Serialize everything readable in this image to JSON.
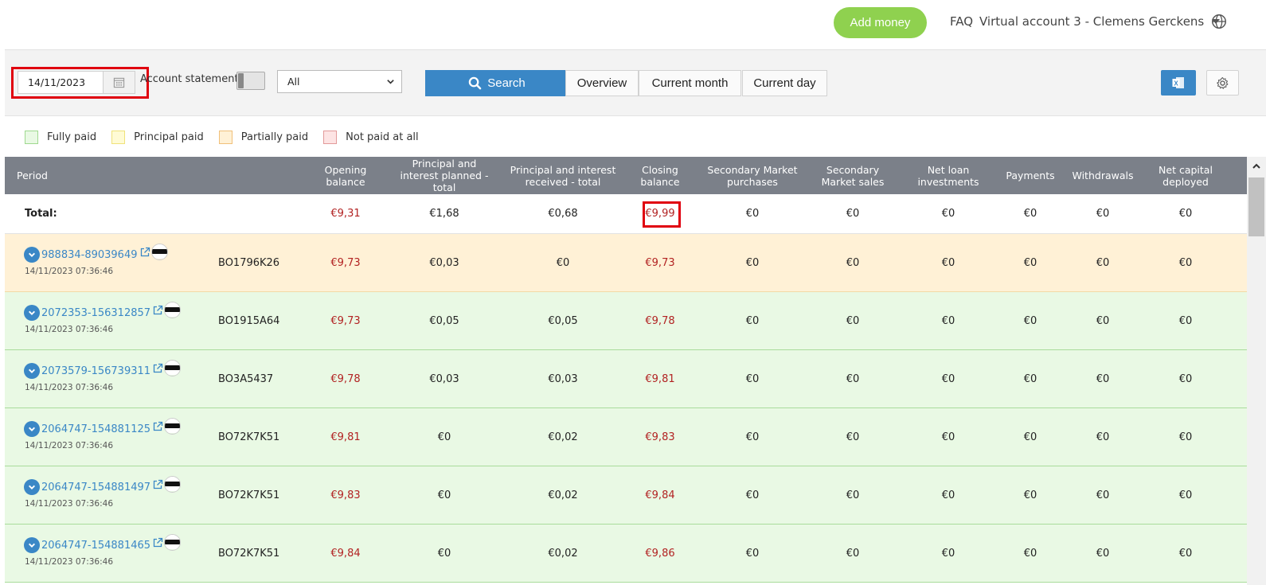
{
  "header": {
    "add_money_label": "Add money",
    "faq_label": "FAQ",
    "account_label": "Virtual account 3 - Clemens Gerckens",
    "icons": [
      "chevron-down-icon",
      "globe-icon"
    ]
  },
  "filters": {
    "date_value": "14/11/2023",
    "account_statement_label": "Account statement",
    "select_value": "All",
    "search_label": "Search",
    "overview_label": "Overview",
    "current_month_label": "Current month",
    "current_day_label": "Current day",
    "icons": [
      "calendar-icon",
      "search-icon",
      "excel-icon",
      "gear-icon"
    ]
  },
  "legend": [
    {
      "label": "Fully paid",
      "fill": "#e9f9e4",
      "border": "#9fd98f"
    },
    {
      "label": "Principal paid",
      "fill": "#fffbd5",
      "border": "#f0e27a"
    },
    {
      "label": "Partially paid",
      "fill": "#fff1d6",
      "border": "#f0c07a"
    },
    {
      "label": "Not paid at all",
      "fill": "#fde4e4",
      "border": "#e29a9a"
    }
  ],
  "table": {
    "columns": [
      "Period",
      "Opening balance",
      "Principal and interest planned - total",
      "Principal and interest received - total",
      "Closing balance",
      "Secondary Market purchases",
      "Secondary Market sales",
      "Net loan investments",
      "Payments",
      "Withdrawals",
      "Net capital deployed"
    ],
    "total": {
      "label": "Total:",
      "opening": "€9,31",
      "planned": "€1,68",
      "received": "€0,68",
      "closing": "€9,99",
      "sm_purchases": "€0",
      "sm_sales": "€0",
      "net_loan": "€0",
      "payments": "€0",
      "withdrawals": "€0",
      "net_capital": "€0"
    },
    "rows": [
      {
        "status": "partial",
        "loan_id": "988834-89039649",
        "datetime": "14/11/2023 07:36:46",
        "code": "BO1796K26",
        "opening": "€9,73",
        "planned": "€0,03",
        "received": "€0",
        "closing": "€9,73",
        "sm_purchases": "€0",
        "sm_sales": "€0",
        "net_loan": "€0",
        "payments": "€0",
        "withdrawals": "€0",
        "net_capital": "€0"
      },
      {
        "status": "full",
        "loan_id": "2072353-156312857",
        "datetime": "14/11/2023 07:36:46",
        "code": "BO1915A64",
        "opening": "€9,73",
        "planned": "€0,05",
        "received": "€0,05",
        "closing": "€9,78",
        "sm_purchases": "€0",
        "sm_sales": "€0",
        "net_loan": "€0",
        "payments": "€0",
        "withdrawals": "€0",
        "net_capital": "€0"
      },
      {
        "status": "full",
        "loan_id": "2073579-156739311",
        "datetime": "14/11/2023 07:36:46",
        "code": "BO3A5437",
        "opening": "€9,78",
        "planned": "€0,03",
        "received": "€0,03",
        "closing": "€9,81",
        "sm_purchases": "€0",
        "sm_sales": "€0",
        "net_loan": "€0",
        "payments": "€0",
        "withdrawals": "€0",
        "net_capital": "€0"
      },
      {
        "status": "full",
        "loan_id": "2064747-154881125",
        "datetime": "14/11/2023 07:36:46",
        "code": "BO72K7K51",
        "opening": "€9,81",
        "planned": "€0",
        "received": "€0,02",
        "closing": "€9,83",
        "sm_purchases": "€0",
        "sm_sales": "€0",
        "net_loan": "€0",
        "payments": "€0",
        "withdrawals": "€0",
        "net_capital": "€0"
      },
      {
        "status": "full",
        "loan_id": "2064747-154881497",
        "datetime": "14/11/2023 07:36:46",
        "code": "BO72K7K51",
        "opening": "€9,83",
        "planned": "€0",
        "received": "€0,02",
        "closing": "€9,84",
        "sm_purchases": "€0",
        "sm_sales": "€0",
        "net_loan": "€0",
        "payments": "€0",
        "withdrawals": "€0",
        "net_capital": "€0"
      },
      {
        "status": "full",
        "loan_id": "2064747-154881465",
        "datetime": "14/11/2023 07:36:46",
        "code": "BO72K7K51",
        "opening": "€9,84",
        "planned": "€0",
        "received": "€0,02",
        "closing": "€9,86",
        "sm_purchases": "€0",
        "sm_sales": "€0",
        "net_loan": "€0",
        "payments": "€0",
        "withdrawals": "€0",
        "net_capital": "€0"
      }
    ],
    "icons": [
      "expand-icon",
      "external-link-icon",
      "estonia-flag-icon"
    ]
  },
  "colors": {
    "accent": "#3a87c6",
    "add_money": "#8fd14f",
    "negative": "#b22222",
    "highlight": "#e0000f",
    "header_bg": "#7b8089"
  }
}
